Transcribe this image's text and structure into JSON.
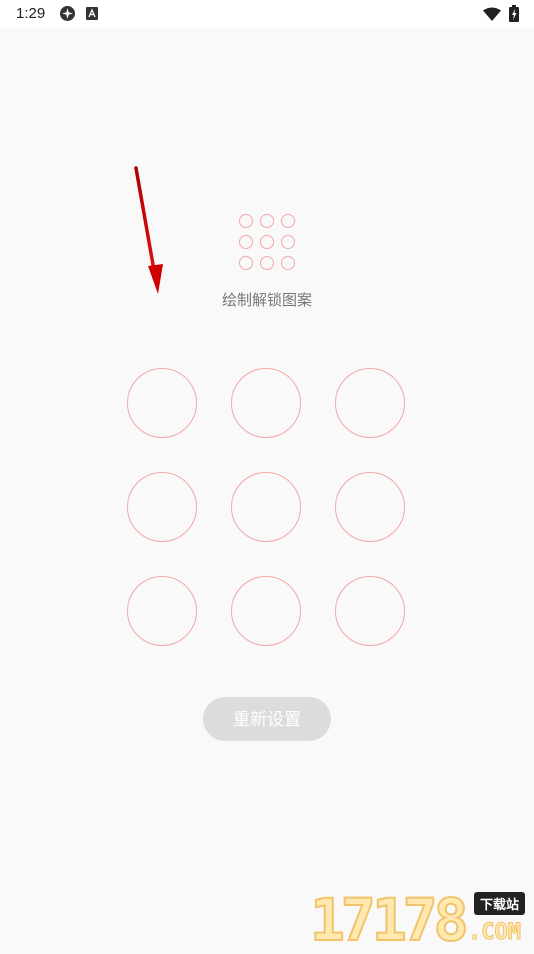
{
  "status_bar": {
    "time": "1:29",
    "icons": [
      "sync-icon",
      "keyboard-a-icon",
      "wifi-icon",
      "battery-icon"
    ]
  },
  "header": {
    "preview_icon": "pattern-preview-icon",
    "prompt": "绘制解锁图案"
  },
  "pattern": {
    "nodes": [
      1,
      2,
      3,
      4,
      5,
      6,
      7,
      8,
      9
    ],
    "accent_color": "#f4a7a7"
  },
  "actions": {
    "reset_label": "重新设置"
  },
  "watermark": {
    "digits": "17178",
    "badge": "下载站",
    "suffix": ".COM"
  }
}
